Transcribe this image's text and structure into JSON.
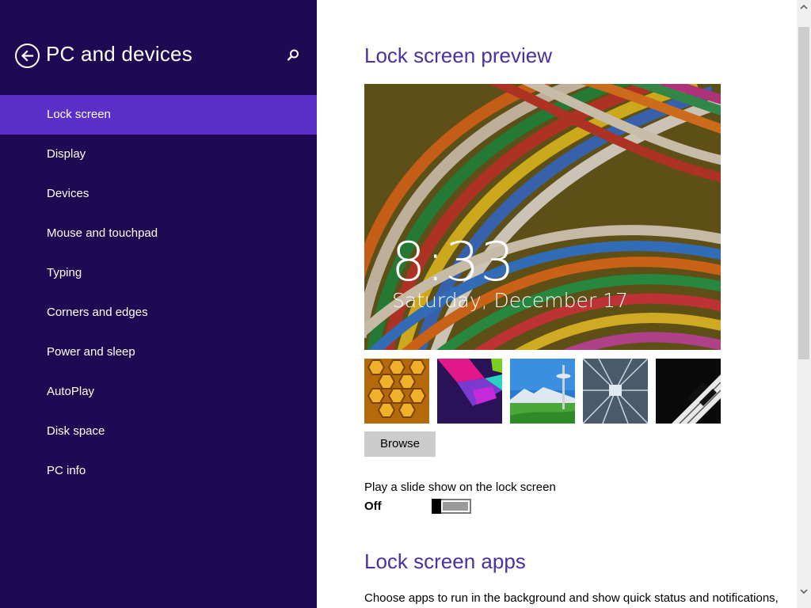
{
  "sidebar": {
    "title": "PC and devices",
    "back_icon": "back-arrow-icon",
    "search_icon": "search-icon",
    "items": [
      {
        "label": "Lock screen",
        "active": true
      },
      {
        "label": "Display"
      },
      {
        "label": "Devices"
      },
      {
        "label": "Mouse and touchpad"
      },
      {
        "label": "Typing"
      },
      {
        "label": "Corners and edges"
      },
      {
        "label": "Power and sleep"
      },
      {
        "label": "AutoPlay"
      },
      {
        "label": "Disk space"
      },
      {
        "label": "PC info"
      }
    ]
  },
  "main": {
    "preview_title": "Lock screen preview",
    "preview_time": "8:33",
    "preview_date": "Saturday, December 17",
    "thumbnails": [
      "honeycomb",
      "colored-shapes",
      "space-needle",
      "tunnel-motion",
      "piano-keys"
    ],
    "browse_label": "Browse",
    "slideshow_label": "Play a slide show on the lock screen",
    "slideshow_state": "Off",
    "slideshow_on": false,
    "apps_title": "Lock screen apps",
    "apps_description": "Choose apps to run in the background and show quick status and notifications,"
  },
  "colors": {
    "sidebar_bg": "#1e0a52",
    "active_item_bg": "#5b2fc9",
    "heading_color": "#4d2fa3",
    "button_bg": "#cccccc"
  }
}
